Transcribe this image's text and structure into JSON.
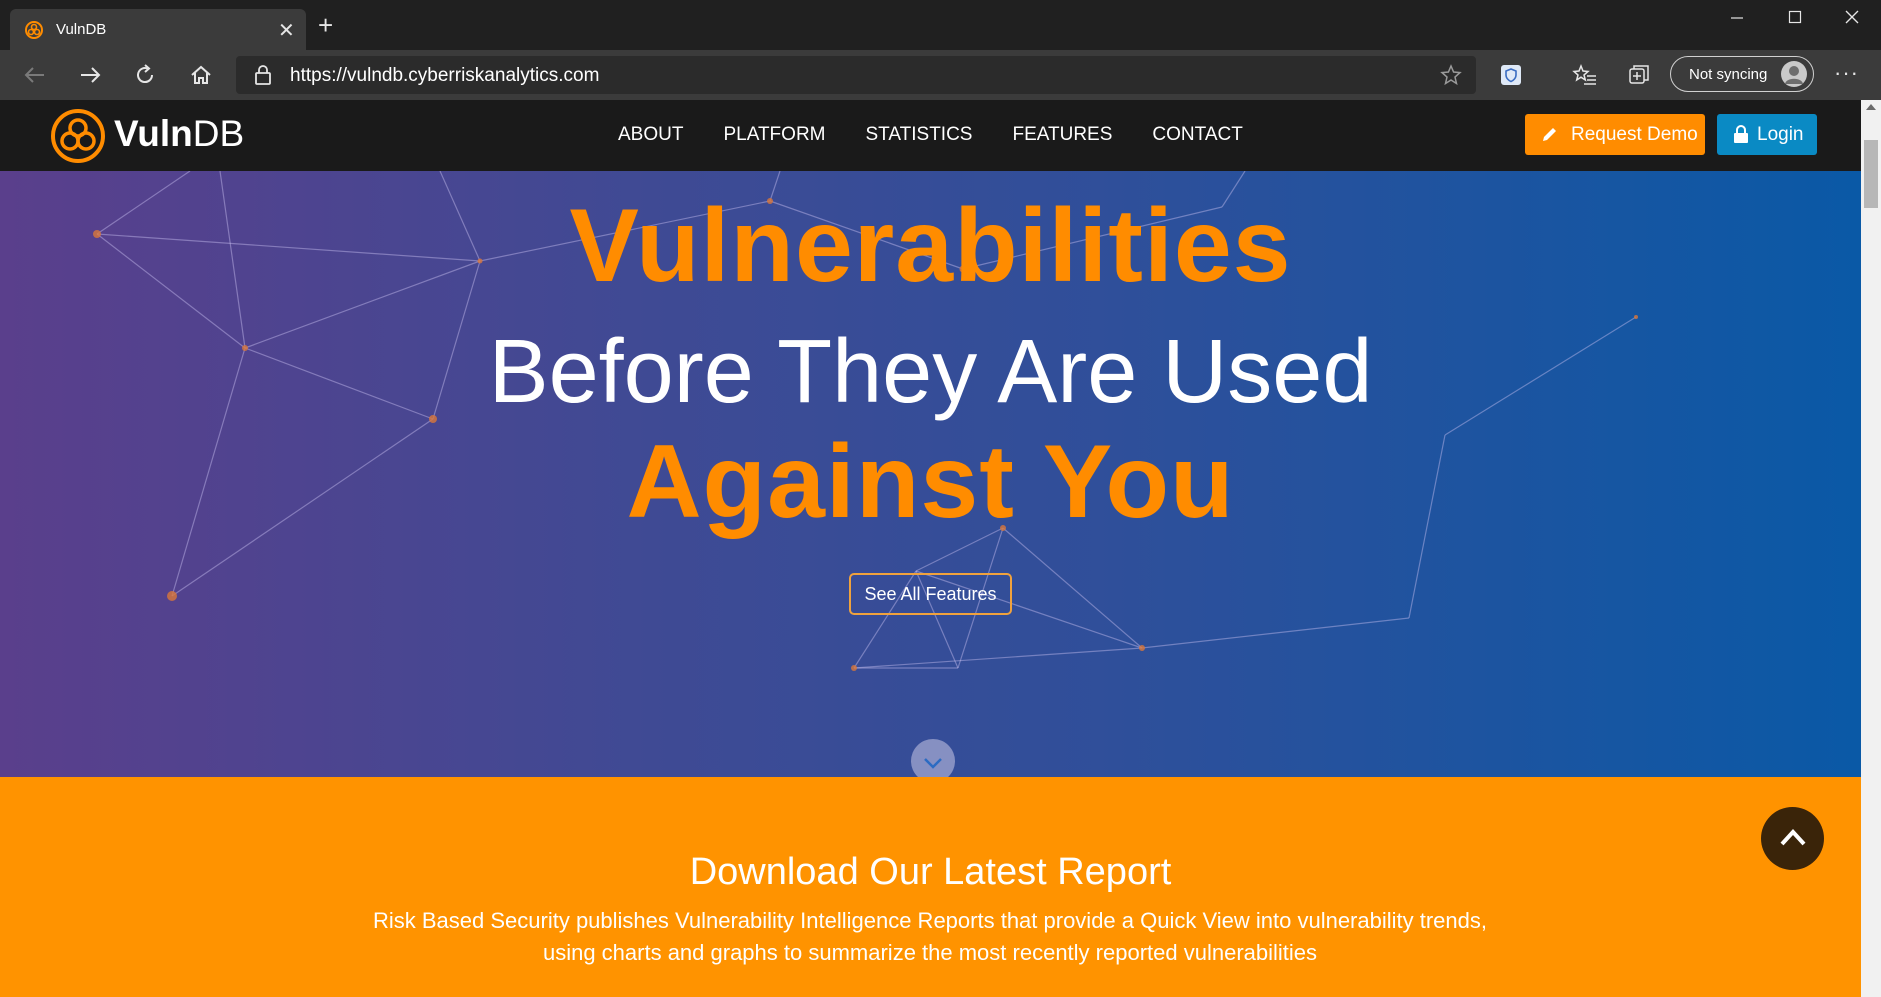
{
  "browser": {
    "tab_title": "VulnDB",
    "url": "https://vulndb.cyberriskanalytics.com",
    "sync_label": "Not syncing",
    "more_label": "···",
    "new_tab_label": "+",
    "close_tab_label": "✕"
  },
  "site": {
    "logo_text_bold": "Vuln",
    "logo_text_light": "DB",
    "nav": [
      "ABOUT",
      "PLATFORM",
      "STATISTICS",
      "FEATURES",
      "CONTACT"
    ],
    "request_demo_label": "Request Demo",
    "login_label": "Login"
  },
  "hero": {
    "line1": "Vulnerabilities",
    "line2": "Before They Are Used",
    "line3": "Against You",
    "cta_label": "See All Features"
  },
  "report": {
    "title": "Download Our Latest Report",
    "line1": "Risk Based Security publishes Vulnerability Intelligence Reports that provide a Quick View into vulnerability trends,",
    "line2": "using charts and graphs to summarize the most recently reported vulnerabilities"
  },
  "colors": {
    "accent_orange": "#ff8c00",
    "login_blue": "#0a8ac4",
    "nav_bg": "#1a1a1a"
  }
}
